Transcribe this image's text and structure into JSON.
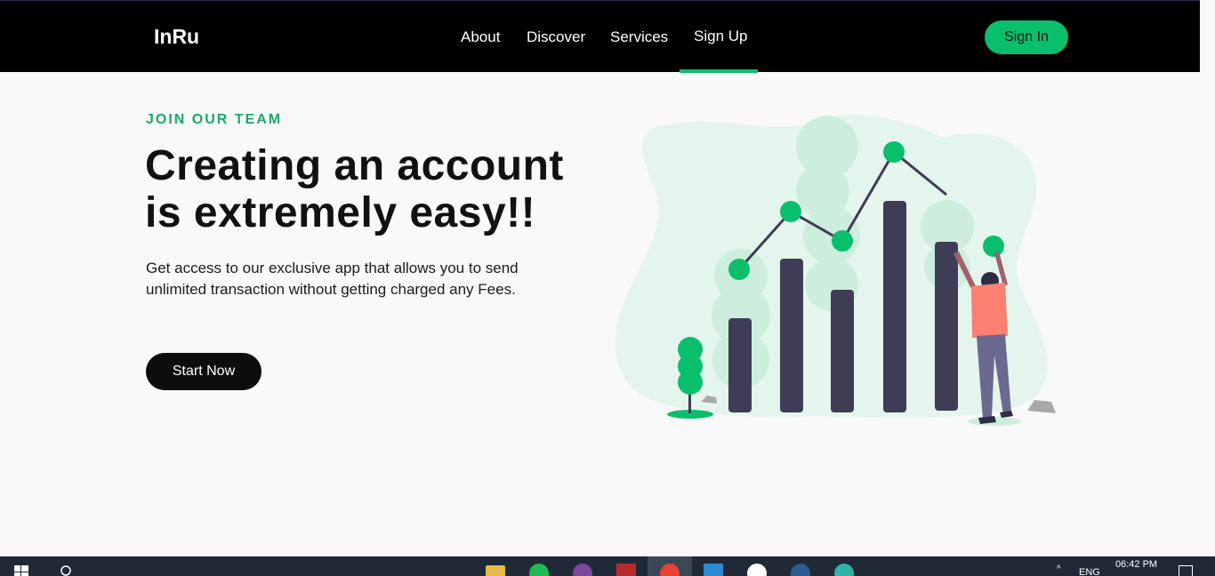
{
  "navbar": {
    "brand": "InRu",
    "links": [
      "About",
      "Discover",
      "Services",
      "Sign Up"
    ],
    "active_link": "Sign Up",
    "signin_label": "Sign In"
  },
  "hero": {
    "eyebrow": "JOIN OUR TEAM",
    "headline_line1": "Creating an account",
    "headline_line2": "is extremely easy!!",
    "description": "Get access to our exclusive app that allows you to send unlimited transaction without getting charged any Fees.",
    "cta_label": "Start Now"
  },
  "colors": {
    "accent": "#09bf6b",
    "nav_bg": "#000000",
    "bar_dark": "#3f3d56",
    "blob": "#dff3ea"
  },
  "taskbar": {
    "icons": [
      "windows-start-icon",
      "search-icon",
      "file-explorer-icon",
      "spotify-icon",
      "tor-browser-icon",
      "winrar-icon",
      "chrome-icon",
      "vscode-icon",
      "mailbird-icon",
      "steam-icon",
      "edge-icon"
    ],
    "language": "ENG",
    "time": "06:42 PM"
  }
}
